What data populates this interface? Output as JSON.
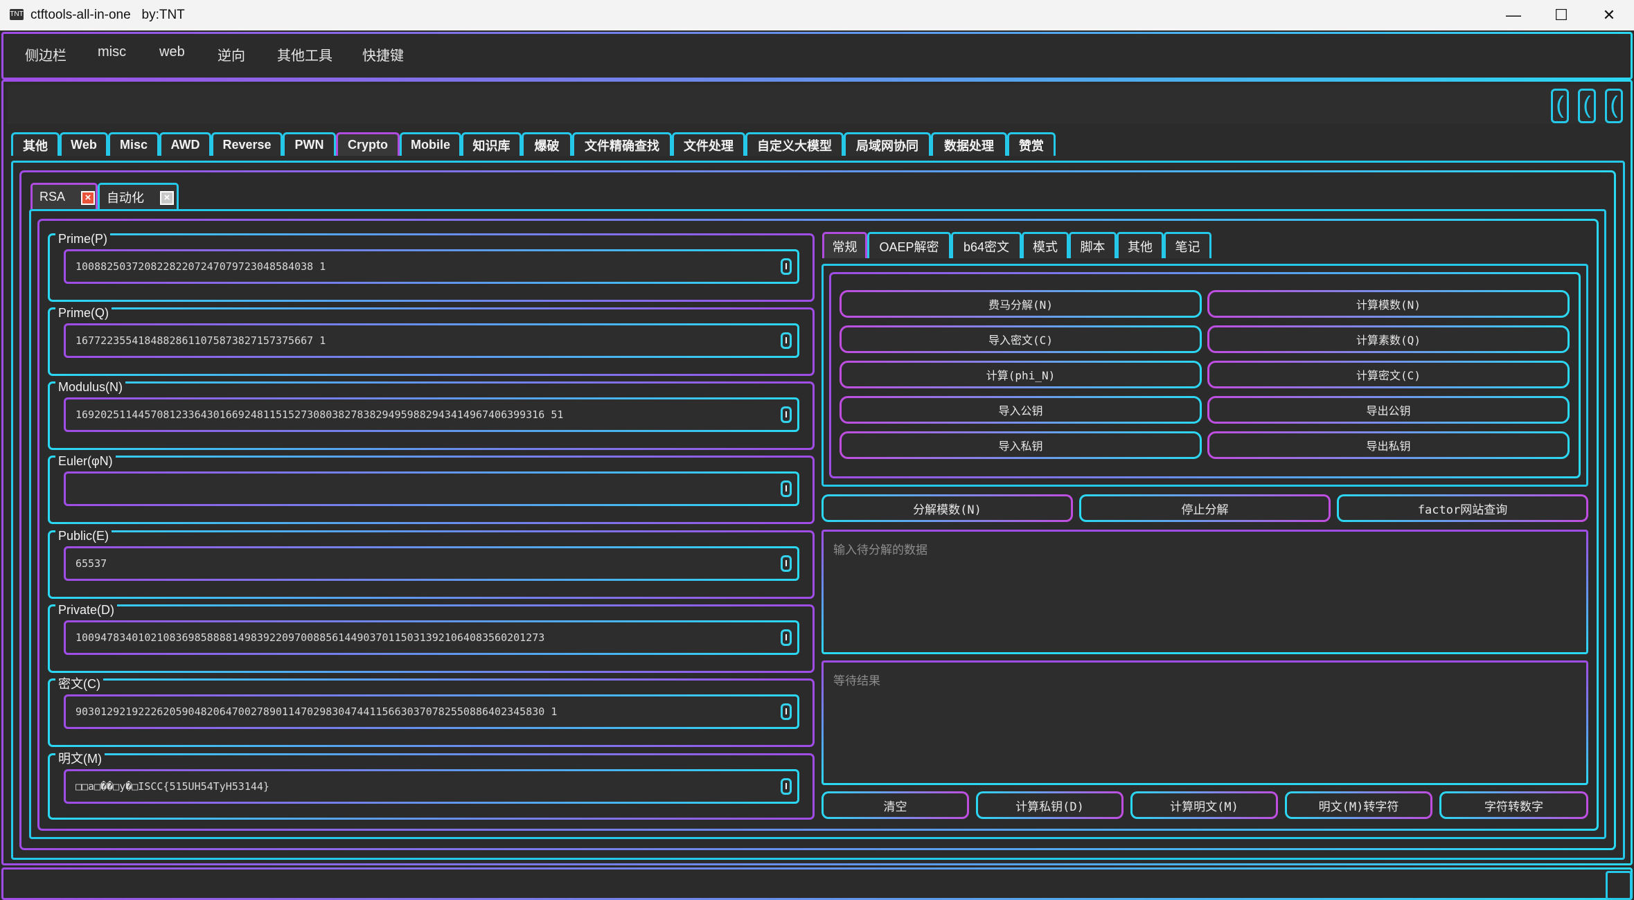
{
  "window": {
    "title": "ctftools-all-in-one   by:TNT",
    "minimize": "—",
    "maximize": "☐",
    "close": "✕"
  },
  "menu": [
    "侧边栏",
    "misc",
    "web",
    "逆向",
    "其他工具",
    "快捷键"
  ],
  "main_tabs": [
    "其他",
    "Web",
    "Misc",
    "AWD",
    "Reverse",
    "PWN",
    "Crypto",
    "Mobile",
    "知识库",
    "爆破",
    "文件精确查找",
    "文件处理",
    "自定义大模型",
    "局域网协同",
    "数据处理",
    "赞赏"
  ],
  "active_main_tab": "Crypto",
  "sub_tabs": [
    {
      "label": "RSA",
      "close": "×",
      "close_color": "#e8533a"
    },
    {
      "label": "自动化",
      "close": "×",
      "close_color": "#c8c8c8"
    }
  ],
  "rsa_fields": [
    {
      "label": "Prime(P)",
      "value": "10088250372082282207247079723048584038 1"
    },
    {
      "label": "Prime(Q)",
      "value": "16772235541848828611075873827157375667 1"
    },
    {
      "label": "Modulus(N)",
      "value": "169202511445708123364301669248115152730803827838294959882943414967406399316 51"
    },
    {
      "label": "Euler(φN)",
      "value": ""
    },
    {
      "label": "Public(E)",
      "value": "65537"
    },
    {
      "label": "Private(D)",
      "value": "100947834010210836985888814983922097008856144903701150313921064083560201273"
    },
    {
      "label": "密文(C)",
      "value": "903012921922262059048206470027890114702983047441156630370782550886402345830 1"
    },
    {
      "label": "明文(M)",
      "value": "□□a□��□y�□ISCC{515UH54TyH53144}"
    }
  ],
  "field_icon": "I",
  "right_tabs": [
    "常规",
    "OAEP解密",
    "b64密文",
    "模式",
    "脚本",
    "其他",
    "笔记"
  ],
  "active_right_tab": "常规",
  "op_buttons": [
    "费马分解(N)",
    "计算模数(N)",
    "导入密文(C)",
    "计算素数(Q)",
    "计算(phi_N)",
    "计算密文(C)",
    "导入公钥",
    "导出公钥",
    "导入私钥",
    "导出私钥"
  ],
  "factor_buttons": [
    "分解模数(N)",
    "停止分解",
    "factor网站查询"
  ],
  "input_placeholder": "输入待分解的数据",
  "result_placeholder": "等待结果",
  "bottom_buttons": [
    "清空",
    "计算私钥(D)",
    "计算明文(M)",
    "明文(M)转字符",
    "字符转数字"
  ],
  "colors": {
    "accent_cyan": "#25c8e8",
    "accent_purple": "#a04ce6",
    "background": "#2b2b2b"
  }
}
